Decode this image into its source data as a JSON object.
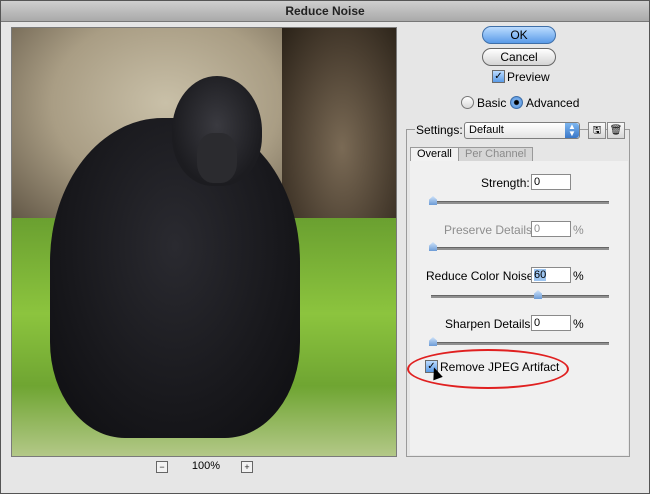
{
  "window": {
    "title": "Reduce Noise"
  },
  "preview": {
    "zoom": "100%",
    "zoom_out_glyph": "−",
    "zoom_in_glyph": "+"
  },
  "buttons": {
    "ok": "OK",
    "cancel": "Cancel"
  },
  "preview_checkbox": {
    "label": "Preview",
    "checked": true
  },
  "mode": {
    "basic": "Basic",
    "advanced": "Advanced",
    "selected": "Advanced"
  },
  "settings": {
    "label": "Settings:",
    "value": "Default",
    "save_icon": "save-settings-icon",
    "delete_icon": "trash-icon"
  },
  "tabs": [
    {
      "label": "Overall",
      "active": true
    },
    {
      "label": "Per Channel",
      "active": false
    }
  ],
  "controls": {
    "strength": {
      "label": "Strength:",
      "value": "0",
      "unit": ""
    },
    "preserve_details": {
      "label": "Preserve Details:",
      "value": "0",
      "unit": "%"
    },
    "reduce_color_noise": {
      "label": "Reduce Color Noise:",
      "value": "60",
      "unit": "%"
    },
    "sharpen_details": {
      "label": "Sharpen Details:",
      "value": "0",
      "unit": "%"
    },
    "remove_jpeg": {
      "label": "Remove JPEG Artifact",
      "checked": true
    }
  },
  "accent": {
    "highlight_color": "#e02020",
    "button_blue": "#5a9be8"
  }
}
